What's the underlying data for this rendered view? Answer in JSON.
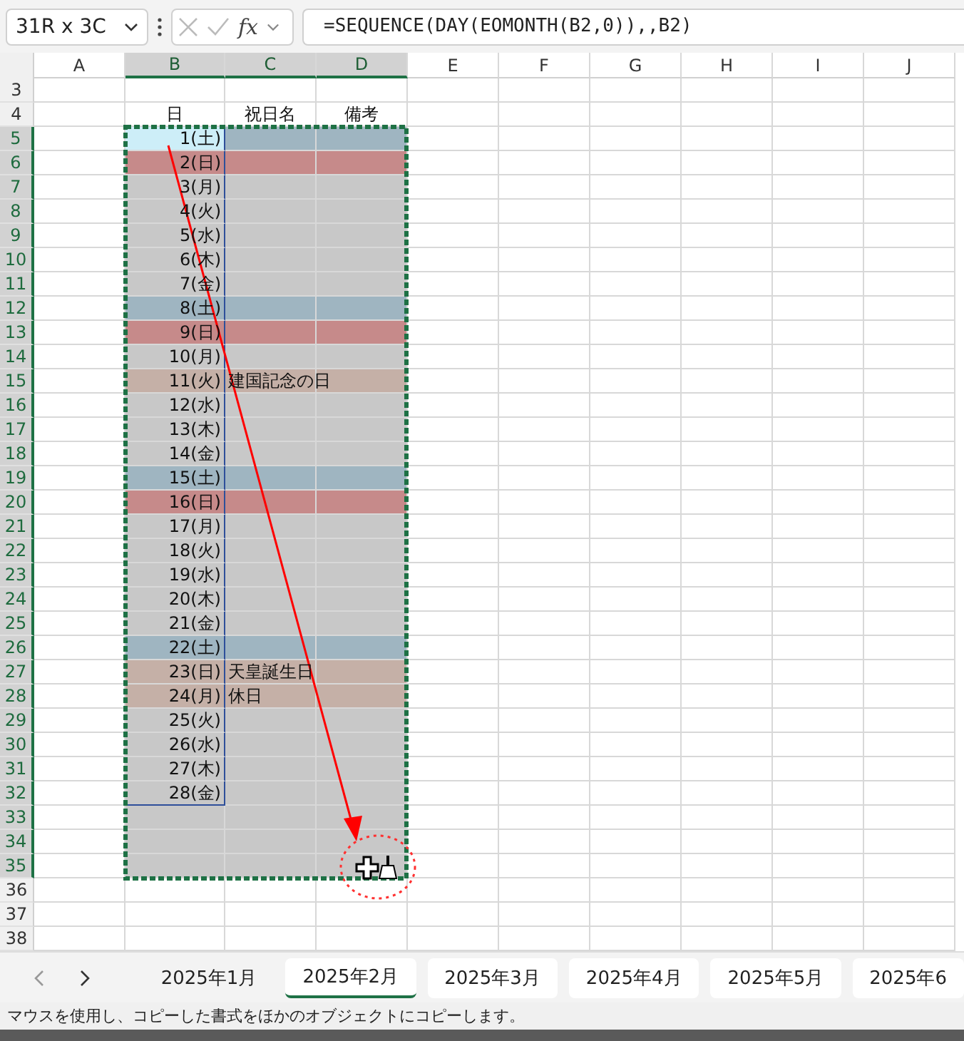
{
  "formula_bar": {
    "name_box": "31R x 3C",
    "function_label": "fx",
    "formula": "=SEQUENCE(DAY(EOMONTH(B2,0)),,B2)"
  },
  "columns": [
    {
      "label": "A",
      "selected": false
    },
    {
      "label": "B",
      "selected": true
    },
    {
      "label": "C",
      "selected": true
    },
    {
      "label": "D",
      "selected": true
    },
    {
      "label": "E",
      "selected": false
    },
    {
      "label": "F",
      "selected": false
    },
    {
      "label": "G",
      "selected": false
    },
    {
      "label": "H",
      "selected": false
    },
    {
      "label": "I",
      "selected": false
    },
    {
      "label": "J",
      "selected": false
    }
  ],
  "rows": [
    {
      "number": "3",
      "kind": "blank",
      "selected": false
    },
    {
      "number": "4",
      "kind": "header",
      "selected": false,
      "labels": [
        "日",
        "祝日名",
        "備考"
      ]
    },
    {
      "number": "5",
      "kind": "saturday",
      "selected": true,
      "active": true,
      "day": "1(土)"
    },
    {
      "number": "6",
      "kind": "sunday",
      "selected": true,
      "active": false,
      "day": "2(日)"
    },
    {
      "number": "7",
      "kind": "weekday",
      "selected": true,
      "active": false,
      "day": "3(月)"
    },
    {
      "number": "8",
      "kind": "weekday",
      "selected": true,
      "active": false,
      "day": "4(火)"
    },
    {
      "number": "9",
      "kind": "weekday",
      "selected": true,
      "active": false,
      "day": "5(水)"
    },
    {
      "number": "10",
      "kind": "weekday",
      "selected": true,
      "active": false,
      "day": "6(木)"
    },
    {
      "number": "11",
      "kind": "weekday",
      "selected": true,
      "active": false,
      "day": "7(金)"
    },
    {
      "number": "12",
      "kind": "saturday",
      "selected": true,
      "active": false,
      "day": "8(土)"
    },
    {
      "number": "13",
      "kind": "sunday",
      "selected": true,
      "active": false,
      "day": "9(日)"
    },
    {
      "number": "14",
      "kind": "weekday",
      "selected": true,
      "active": false,
      "day": "10(月)"
    },
    {
      "number": "15",
      "kind": "holiday",
      "selected": true,
      "active": false,
      "day": "11(火)",
      "holiday": "建国記念の日"
    },
    {
      "number": "16",
      "kind": "weekday",
      "selected": true,
      "active": false,
      "day": "12(水)"
    },
    {
      "number": "17",
      "kind": "weekday",
      "selected": true,
      "active": false,
      "day": "13(木)"
    },
    {
      "number": "18",
      "kind": "weekday",
      "selected": true,
      "active": false,
      "day": "14(金)"
    },
    {
      "number": "19",
      "kind": "saturday",
      "selected": true,
      "active": false,
      "day": "15(土)"
    },
    {
      "number": "20",
      "kind": "sunday",
      "selected": true,
      "active": false,
      "day": "16(日)"
    },
    {
      "number": "21",
      "kind": "weekday",
      "selected": true,
      "active": false,
      "day": "17(月)"
    },
    {
      "number": "22",
      "kind": "weekday",
      "selected": true,
      "active": false,
      "day": "18(火)"
    },
    {
      "number": "23",
      "kind": "weekday",
      "selected": true,
      "active": false,
      "day": "19(水)"
    },
    {
      "number": "24",
      "kind": "weekday",
      "selected": true,
      "active": false,
      "day": "20(木)"
    },
    {
      "number": "25",
      "kind": "weekday",
      "selected": true,
      "active": false,
      "day": "21(金)"
    },
    {
      "number": "26",
      "kind": "saturday",
      "selected": true,
      "active": false,
      "day": "22(土)"
    },
    {
      "number": "27",
      "kind": "holiday",
      "selected": true,
      "active": false,
      "day": "23(日)",
      "holiday": "天皇誕生日"
    },
    {
      "number": "28",
      "kind": "holiday",
      "selected": true,
      "active": false,
      "day": "24(月)",
      "holiday": "休日"
    },
    {
      "number": "29",
      "kind": "weekday",
      "selected": true,
      "active": false,
      "day": "25(火)"
    },
    {
      "number": "30",
      "kind": "weekday",
      "selected": true,
      "active": false,
      "day": "26(水)"
    },
    {
      "number": "31",
      "kind": "weekday",
      "selected": true,
      "active": false,
      "day": "27(木)"
    },
    {
      "number": "32",
      "kind": "weekday",
      "selected": true,
      "active": false,
      "day": "28(金)"
    },
    {
      "number": "33",
      "kind": "filler",
      "selected": true
    },
    {
      "number": "34",
      "kind": "filler",
      "selected": true
    },
    {
      "number": "35",
      "kind": "filler",
      "selected": true
    },
    {
      "number": "36",
      "kind": "blank",
      "selected": false
    },
    {
      "number": "37",
      "kind": "blank",
      "selected": false
    },
    {
      "number": "38",
      "kind": "blank",
      "selected": false
    }
  ],
  "sheet_tabs": [
    {
      "label": "2025年1月",
      "selected": false
    },
    {
      "label": "2025年2月",
      "selected": true
    },
    {
      "label": "2025年3月",
      "selected": false
    },
    {
      "label": "2025年4月",
      "selected": false
    },
    {
      "label": "2025年5月",
      "selected": false
    },
    {
      "label": "2025年6",
      "selected": false
    }
  ],
  "status_bar": "マウスを使用し、コピーした書式をほかのオブジェクトにコピーします。"
}
